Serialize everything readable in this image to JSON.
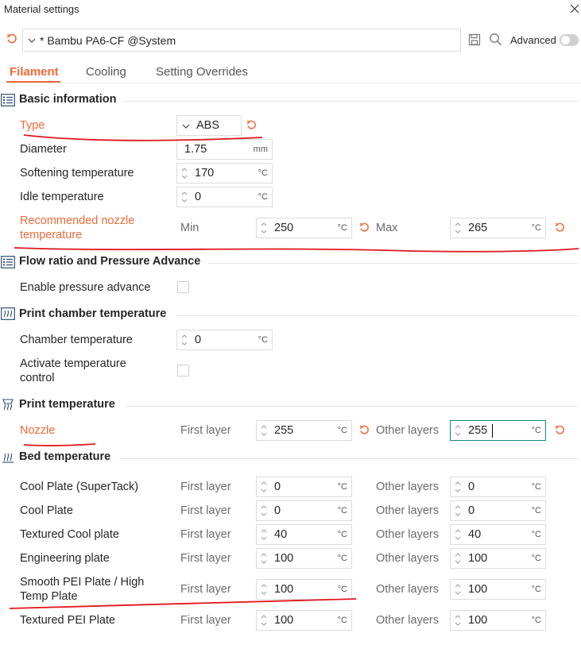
{
  "window": {
    "title": "Material settings"
  },
  "preset": {
    "name": "* Bambu PA6-CF @System",
    "advanced_label": "Advanced"
  },
  "tabs": [
    "Filament",
    "Cooling",
    "Setting Overrides"
  ],
  "sections": {
    "basic": {
      "title": "Basic information"
    },
    "flow": {
      "title": "Flow ratio and Pressure Advance"
    },
    "chamber": {
      "title": "Print chamber temperature"
    },
    "print_temp": {
      "title": "Print temperature"
    },
    "bed": {
      "title": "Bed temperature"
    }
  },
  "basic": {
    "type_label": "Type",
    "type_value": "ABS",
    "diameter_label": "Diameter",
    "diameter_value": "1.75",
    "diameter_unit": "mm",
    "softening_label": "Softening temperature",
    "softening_value": "170",
    "idle_label": "Idle temperature",
    "idle_value": "0",
    "rec_label_1": "Recommended nozzle",
    "rec_label_2": "temperature",
    "min_label": "Min",
    "min_value": "250",
    "max_label": "Max",
    "max_value": "265"
  },
  "flow": {
    "pa_label": "Enable pressure advance"
  },
  "chamber": {
    "temp_label": "Chamber temperature",
    "temp_value": "0",
    "activate_label_1": "Activate temperature",
    "activate_label_2": "control"
  },
  "print_temp": {
    "nozzle_label": "Nozzle",
    "first_label": "First layer",
    "first_value": "255",
    "other_label": "Other layers",
    "other_value": "255"
  },
  "bed": {
    "first_label": "First layer",
    "other_label": "Other layers",
    "rows": [
      {
        "label": "Cool Plate (SuperTack)",
        "first": "0",
        "other": "0"
      },
      {
        "label": "Cool Plate",
        "first": "0",
        "other": "0"
      },
      {
        "label": "Textured Cool plate",
        "first": "40",
        "other": "40"
      },
      {
        "label": "Engineering plate",
        "first": "100",
        "other": "100"
      },
      {
        "label": "Smooth PEI Plate / High",
        "label2": "Temp Plate",
        "first": "100",
        "other": "100"
      },
      {
        "label": "Textured PEI Plate",
        "first": "100",
        "other": "100"
      }
    ]
  },
  "units": {
    "celsius": "°C"
  },
  "colors": {
    "accent": "#ee6a39",
    "annotation": "#e0161c",
    "focus": "#0f8a7e"
  }
}
